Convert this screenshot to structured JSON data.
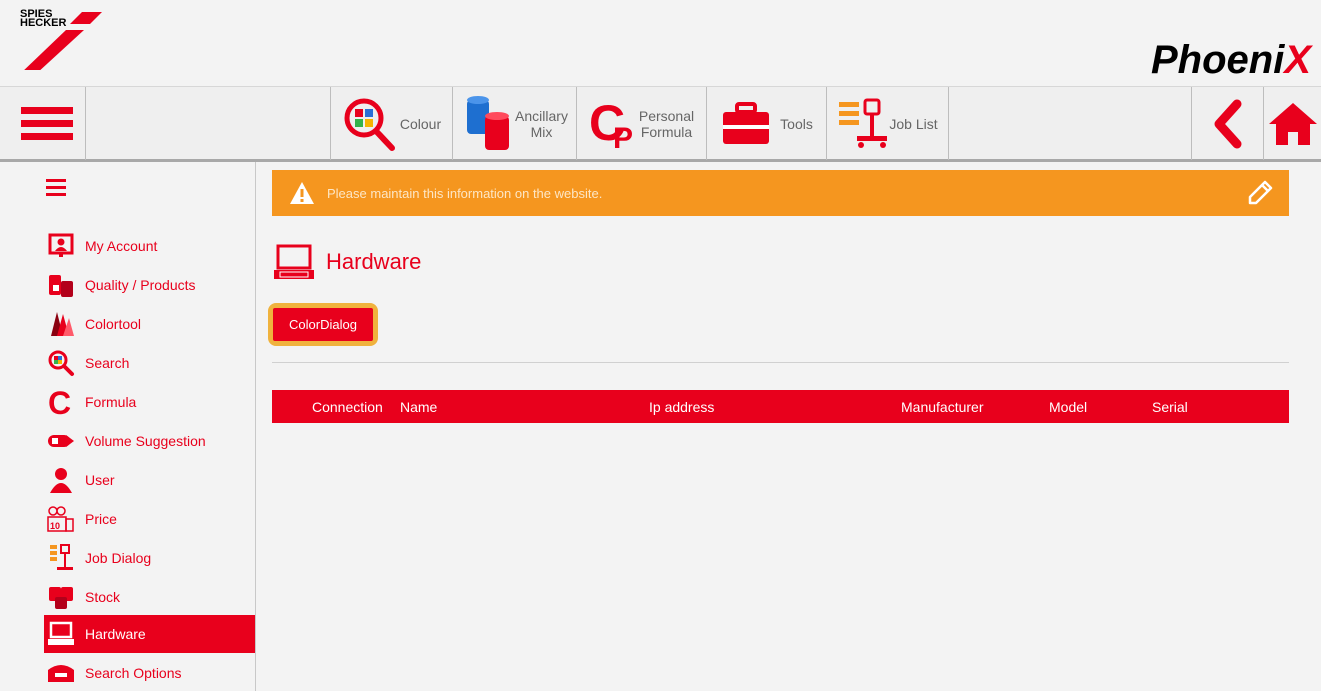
{
  "brand": {
    "logo_line1": "SPIES",
    "logo_line2": "HECKER",
    "app_name": "Phoeni",
    "app_name_x": "X"
  },
  "toolbar": {
    "menu_icon": "hamburger-icon",
    "colour": "Colour",
    "ancillary_line1": "Ancillary",
    "ancillary_line2": "Mix",
    "personal_line1": "Personal",
    "personal_line2": "Formula",
    "tools": "Tools",
    "job_list": "Job List",
    "back_icon": "chevron-left-icon",
    "home_icon": "home-icon"
  },
  "sidebar": {
    "items": [
      {
        "label": "My Account",
        "icon": "account-icon"
      },
      {
        "label": "Quality / Products",
        "icon": "products-icon"
      },
      {
        "label": "Colortool",
        "icon": "colortool-icon"
      },
      {
        "label": "Search",
        "icon": "search-icon"
      },
      {
        "label": "Formula",
        "icon": "formula-icon"
      },
      {
        "label": "Volume Suggestion",
        "icon": "volume-icon"
      },
      {
        "label": "User",
        "icon": "user-icon"
      },
      {
        "label": "Price",
        "icon": "price-icon"
      },
      {
        "label": "Job Dialog",
        "icon": "job-dialog-icon"
      },
      {
        "label": "Stock",
        "icon": "stock-icon"
      },
      {
        "label": "Hardware",
        "icon": "hardware-icon",
        "active": true
      },
      {
        "label": "Search Options",
        "icon": "search-options-icon"
      }
    ]
  },
  "main": {
    "warning": "Please maintain this information on the website.",
    "title": "Hardware",
    "color_dialog_button": "ColorDialog",
    "table_headers": [
      "Connection",
      "Name",
      "Ip address",
      "Manufacturer",
      "Model",
      "Serial"
    ]
  },
  "colors": {
    "accent": "#e8001c",
    "warning": "#f5961f",
    "button_outline": "#f0b23d"
  }
}
